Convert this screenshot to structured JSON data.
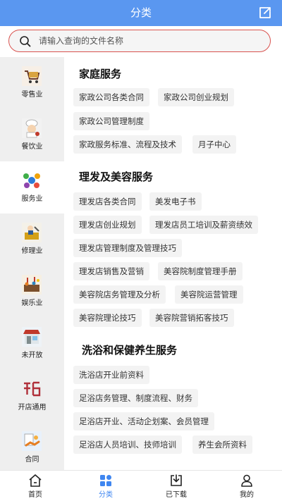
{
  "header": {
    "title": "分类"
  },
  "search": {
    "placeholder": "请输入查询的文件名称"
  },
  "colors": {
    "header": "#5a97f0",
    "accent": "#3f86f0",
    "search_border": "#d9534f"
  },
  "sidebar": {
    "items": [
      {
        "label": "零售业",
        "icon": "cart-icon"
      },
      {
        "label": "餐饮业",
        "icon": "chef-icon"
      },
      {
        "label": "服务业",
        "icon": "service-icon",
        "active": true
      },
      {
        "label": "修理业",
        "icon": "repair-icon"
      },
      {
        "label": "娱乐业",
        "icon": "music-icon"
      },
      {
        "label": "未开放",
        "icon": "shop-icon"
      },
      {
        "label": "开店通用",
        "icon": "open-store-icon"
      },
      {
        "label": "合同",
        "icon": "handshake-icon"
      }
    ]
  },
  "sections": [
    {
      "title": "家庭服务",
      "tags": [
        "家政公司各类合同",
        "家政公司创业规划",
        "家政公司管理制度",
        "家政服务标准、流程及技术",
        "月子中心"
      ]
    },
    {
      "title": "理发及美容服务",
      "tags": [
        "理发店各类合同",
        "美发电子书",
        "理发店创业规划",
        "理发店员工培训及薪资绩效",
        "理发店管理制度及管理技巧",
        "理发店销售及营销",
        "美容院制度管理手册",
        "美容院店务管理及分析",
        "美容院运营管理",
        "美容院理论技巧",
        "美容院营销拓客技巧"
      ]
    },
    {
      "title": "洗浴和保健养生服务",
      "tags": [
        "洗浴店开业前资料",
        "足浴店务管理、制度流程、财务",
        "足浴店开业、活动企划案、会员管理",
        "足浴店人员培训、技师培训",
        "养生会所资料"
      ]
    }
  ],
  "tabbar": {
    "items": [
      {
        "label": "首页",
        "icon": "home-icon"
      },
      {
        "label": "分类",
        "icon": "category-icon",
        "active": true
      },
      {
        "label": "已下载",
        "icon": "download-icon"
      },
      {
        "label": "我的",
        "icon": "user-icon"
      }
    ]
  }
}
